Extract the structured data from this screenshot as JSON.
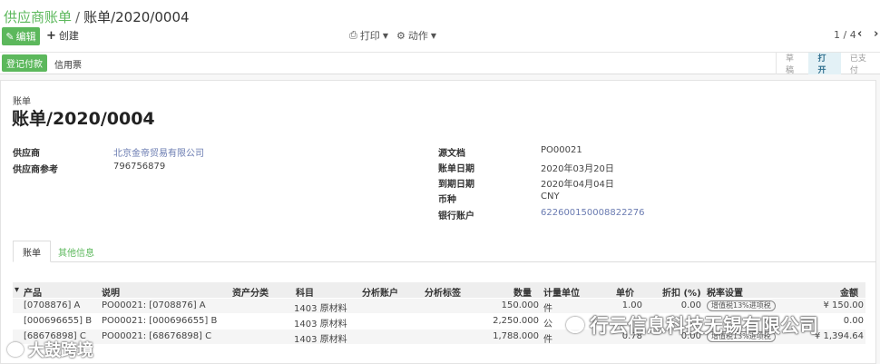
{
  "breadcrumb": {
    "parent": "供应商账单",
    "separator": "/",
    "current": "账单/2020/0004"
  },
  "toolbar": {
    "edit_label": "编辑",
    "create_label": "创建",
    "print_label": "打印",
    "action_label": "动作"
  },
  "pager": {
    "value": "1 / 4",
    "prev": "‹",
    "next": "›"
  },
  "statusbar": {
    "register_payment_label": "登记付款",
    "credit_note_label": "信用票",
    "steps": [
      "草稿",
      "打开",
      "已支付"
    ],
    "active_step": "打开"
  },
  "document": {
    "type_label": "账单",
    "title": "账单/2020/0004",
    "left_fields": [
      {
        "label": "供应商",
        "value": "北京金帝贸易有限公司"
      },
      {
        "label": "供应商参考",
        "value": "796756879"
      }
    ],
    "right_fields": [
      {
        "label": "源文档",
        "value": "PO00021"
      },
      {
        "label": "账单日期",
        "value": "2020年03月20日"
      },
      {
        "label": "到期日期",
        "value": "2020年04月04日"
      },
      {
        "label": "币种",
        "value": "CNY"
      },
      {
        "label": "银行账户",
        "value": "622600150008822276"
      }
    ]
  },
  "tabs": [
    "账单",
    "其他信息"
  ],
  "invoice_lines": {
    "headers": {
      "product": "产品",
      "description": "说明",
      "asset_category": "资产分类",
      "account": "科目",
      "analytic_account": "分析账户",
      "analytic_tags": "分析标签",
      "quantity": "数量",
      "uom": "计量单位",
      "price": "单价",
      "discount": "折扣 (%)",
      "taxes": "税率设置",
      "amount": "金额"
    },
    "rows": [
      {
        "product": "[0708876] A",
        "description": "PO00021: [0708876] A",
        "account": "1403 原材料",
        "quantity": "150.000",
        "uom": "件",
        "price": "1.00",
        "discount": "0.00",
        "tax": "增值税13%进项税",
        "amount": "¥ 150.00"
      },
      {
        "product": "[000696655] B",
        "description": "PO00021: [000696655] B",
        "account": "1403 原材料",
        "quantity": "2,250.000",
        "uom": "公",
        "price": "",
        "discount": "",
        "tax": "",
        "amount": "0.00"
      },
      {
        "product": "[68676898] C",
        "description": "PO00021: [68676898] C",
        "account": "1403 原材料",
        "quantity": "1,788.000",
        "uom": "件",
        "price": "0.78",
        "discount": "0.00",
        "tax": "增值税13%进项税",
        "amount": "¥ 1,394.64"
      }
    ]
  },
  "watermarks": {
    "right": "行云信息科技无锡有限公司",
    "left": "大鼓跨境"
  }
}
